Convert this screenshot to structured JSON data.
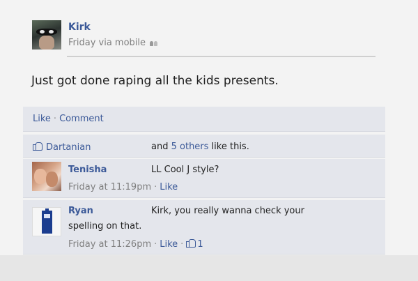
{
  "post": {
    "author": "Kirk",
    "timestamp": "Friday via mobile",
    "privacy_icon": "friends-icon",
    "status": "Just got done raping all the kids presents."
  },
  "actions": {
    "like_label": "Like",
    "separator": "·",
    "comment_label": "Comment"
  },
  "likes": {
    "first_liker": "Dartanian",
    "and_text": "and",
    "others_link": "5 others",
    "suffix": "like this.",
    "icon": "thumbs-up-icon"
  },
  "comments": [
    {
      "author": "Tenisha",
      "text": "LL Cool J style?",
      "timestamp": "Friday at 11:19pm",
      "like_label": "Like"
    },
    {
      "author": "Ryan",
      "text_line1": "Kirk, you really wanna check your",
      "text_line2": "spelling on that.",
      "timestamp": "Friday at 11:26pm",
      "like_label": "Like",
      "like_count": "1"
    }
  ],
  "colors": {
    "link": "#3b5998",
    "panel": "#e4e6ec",
    "background": "#f3f3f3",
    "meta": "#7f7f7f"
  }
}
